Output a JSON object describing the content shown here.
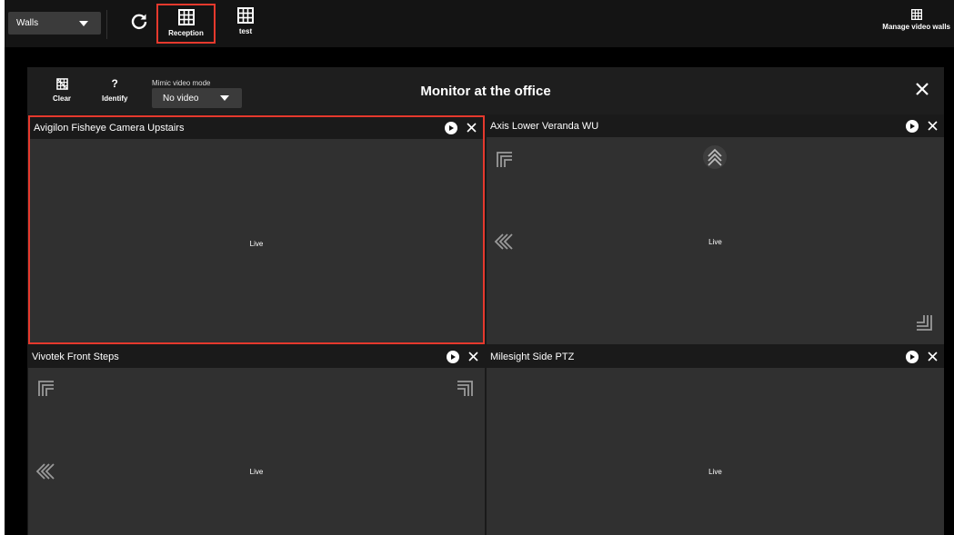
{
  "toolbar": {
    "walls_select": "Walls",
    "refresh_icon": "refresh-icon",
    "walls": [
      {
        "label": "Reception",
        "icon": "grid-icon",
        "selected": true
      },
      {
        "label": "test",
        "icon": "grid-icon",
        "selected": false
      }
    ],
    "manage_label": "Manage video walls"
  },
  "wall": {
    "title": "Monitor at the office",
    "clear_label": "Clear",
    "identify_label": "Identify",
    "identify_glyph": "?",
    "mimic_label": "Mimic video mode",
    "mimic_value": "No video"
  },
  "tiles": [
    {
      "name": "Avigilon Fisheye Camera Upstairs",
      "status": "Live",
      "selected": true
    },
    {
      "name": "Axis Lower Veranda WU",
      "status": "Live",
      "selected": false
    },
    {
      "name": "Vivotek Front Steps",
      "status": "Live",
      "selected": false
    },
    {
      "name": "Milesight Side PTZ",
      "status": "Live",
      "selected": false
    }
  ],
  "colors": {
    "accent": "#e5392d",
    "background": "#000000",
    "tile_bg": "#303030",
    "header_bg": "#1a1a1a"
  }
}
